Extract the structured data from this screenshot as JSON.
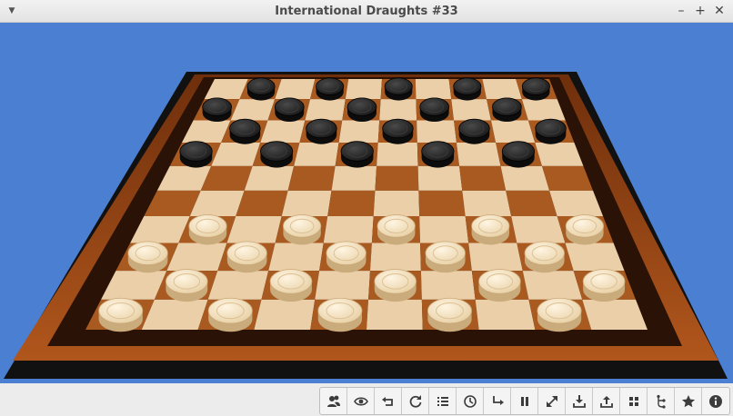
{
  "window": {
    "title": "International Draughts #33"
  },
  "board": {
    "size": 10,
    "dark_rows": 4,
    "light_rows": 4
  },
  "colors": {
    "sky": "#4a7fd1",
    "dark_square": "#a85a20",
    "light_square": "#ebcfa8",
    "frame": "#8a3c12",
    "dark_piece": "#222222",
    "light_piece": "#f2ddb6"
  },
  "toolbar": [
    {
      "icon": "players-icon"
    },
    {
      "icon": "eye-icon"
    },
    {
      "icon": "undo-icon"
    },
    {
      "icon": "restart-icon"
    },
    {
      "icon": "move-list-icon"
    },
    {
      "icon": "clock-icon"
    },
    {
      "icon": "redo-icon"
    },
    {
      "icon": "pause-icon"
    },
    {
      "icon": "fullscreen-icon"
    },
    {
      "icon": "import-icon"
    },
    {
      "icon": "export-icon"
    },
    {
      "icon": "board-icon"
    },
    {
      "icon": "tree-icon"
    },
    {
      "icon": "star-icon"
    },
    {
      "icon": "info-icon"
    }
  ]
}
